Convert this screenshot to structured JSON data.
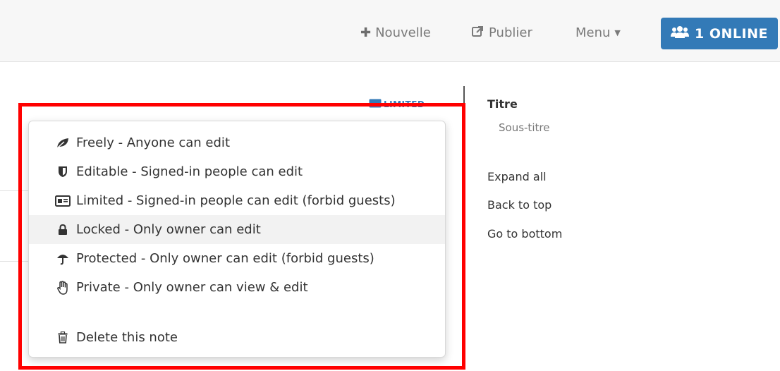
{
  "topbar": {
    "new_label": "Nouvelle",
    "publish_label": "Publier",
    "menu_label": "Menu",
    "online_label": "1 ONLINE",
    "online_color": "#337ab7"
  },
  "editor": {
    "permission_tag": "LIMITED"
  },
  "permission_menu": {
    "items": [
      {
        "icon": "leaf-icon",
        "label": "Freely - Anyone can edit"
      },
      {
        "icon": "shield-icon",
        "label": "Editable - Signed-in people can edit"
      },
      {
        "icon": "id-card-icon",
        "label": "Limited - Signed-in people can edit (forbid guests)"
      },
      {
        "icon": "lock-icon",
        "label": "Locked - Only owner can edit"
      },
      {
        "icon": "umbrella-icon",
        "label": "Protected - Only owner can edit (forbid guests)"
      },
      {
        "icon": "hand-icon",
        "label": "Private - Only owner can view & edit"
      }
    ],
    "delete": {
      "icon": "trash-icon",
      "label": "Delete this note"
    },
    "highlight_color": "#ff0000"
  },
  "toc": {
    "title": "Titre",
    "subtitle": "Sous-titre",
    "expand_all": "Expand all",
    "back_to_top": "Back to top",
    "go_to_bottom": "Go to bottom"
  }
}
